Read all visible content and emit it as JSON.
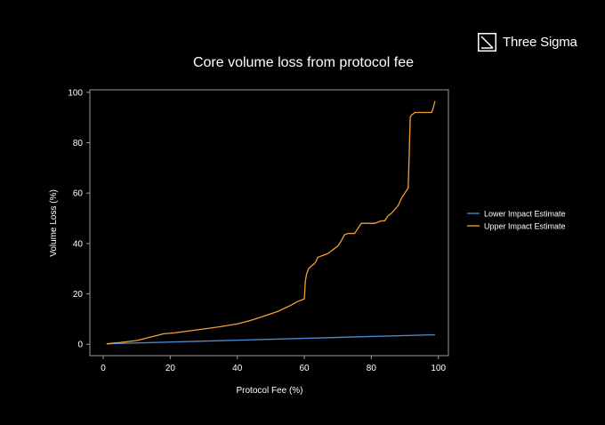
{
  "brand": {
    "name": "Three Sigma",
    "logo_icon": "three-sigma-logo-icon"
  },
  "colors": {
    "background": "#000000",
    "text": "#ffffff",
    "axis": "#9a9a9a",
    "lower": "#4a8fd4",
    "upper": "#f0a132"
  },
  "chart_data": {
    "type": "line",
    "title": "Core volume loss from protocol fee",
    "xlabel": "Protocol Fee (%)",
    "ylabel": "Volume Loss (%)",
    "xlim": [
      -4,
      103
    ],
    "ylim": [
      -4.5,
      101
    ],
    "xticks": [
      0,
      20,
      40,
      60,
      80,
      100
    ],
    "yticks": [
      0,
      20,
      40,
      60,
      80,
      100
    ],
    "grid": false,
    "legend_position": "right-outside",
    "series": [
      {
        "name": "Lower Impact Estimate",
        "color": "#4a8fd4",
        "x": [
          1,
          99
        ],
        "y": [
          0.2,
          3.8
        ]
      },
      {
        "name": "Upper Impact Estimate",
        "color": "#f0a132",
        "x": [
          1,
          5,
          10,
          13,
          16,
          18,
          21,
          25,
          30,
          35,
          40,
          44,
          48,
          52,
          56,
          58,
          60,
          60.3,
          60.7,
          61.3,
          62,
          63,
          63.5,
          64,
          65,
          66,
          67,
          68,
          69,
          70,
          71,
          72,
          73,
          74,
          75,
          76,
          77,
          78,
          79,
          80,
          81,
          82,
          83,
          84,
          85,
          86,
          87,
          88,
          89,
          90,
          91,
          91.3,
          91.6,
          92,
          93,
          94,
          95,
          96,
          97,
          98,
          98.5,
          99
        ],
        "y": [
          0.2,
          0.7,
          1.5,
          2.5,
          3.5,
          4.2,
          4.5,
          5.2,
          6.1,
          7.0,
          8.1,
          9.5,
          11.2,
          13.0,
          15.5,
          17.0,
          18.0,
          25.0,
          28.0,
          30.0,
          31.0,
          32.0,
          33.0,
          34.5,
          35.0,
          35.5,
          36.0,
          37.0,
          38.0,
          39.0,
          41.0,
          43.5,
          44.0,
          44.0,
          44.0,
          46.0,
          48.0,
          48.0,
          48.0,
          48.0,
          48.0,
          48.5,
          49.0,
          49.0,
          51.0,
          52.0,
          53.5,
          55.0,
          58.0,
          60.0,
          62.0,
          75.0,
          90.0,
          91.0,
          92.0,
          92.0,
          92.0,
          92.0,
          92.0,
          92.0,
          94.0,
          96.5
        ]
      }
    ]
  }
}
